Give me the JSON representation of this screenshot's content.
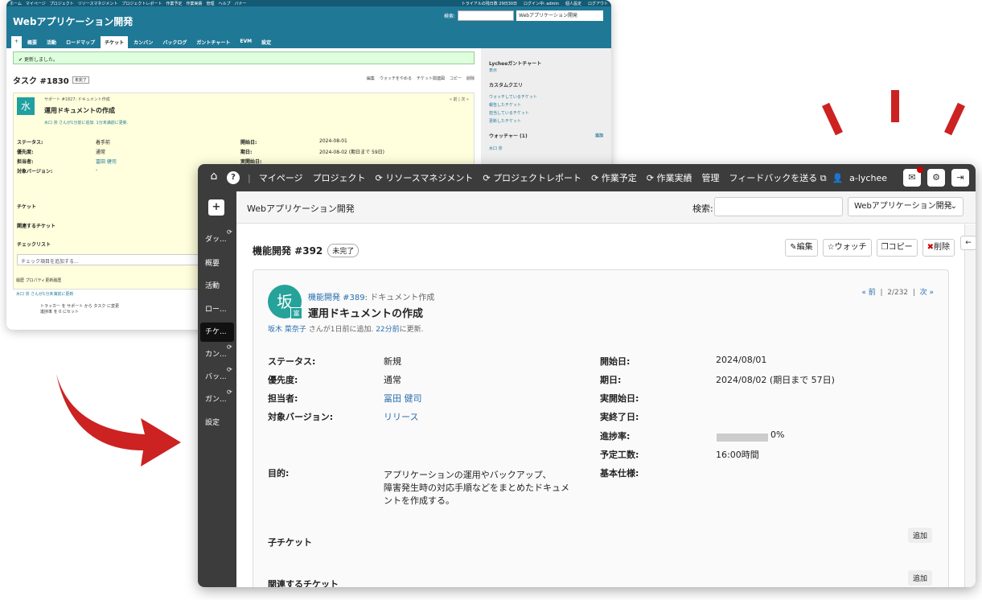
{
  "old": {
    "topbar": [
      "ホーム",
      "マイページ",
      "プロジェクト",
      "リソースマネジメント",
      "プロジェクトレポート",
      "作業予定",
      "作業実績",
      "管理",
      "ヘルプ",
      "バナー"
    ],
    "topbar_right": [
      "トライアルの残日数 29日30日",
      "ログイン中: admin",
      "個人設定",
      "ログアウト"
    ],
    "title": "Webアプリケーション開発",
    "search_label": "検索:",
    "project_select": "Webアプリケーション開発",
    "tabs": [
      "+",
      "概要",
      "活動",
      "ロードマップ",
      "チケット",
      "カンバン",
      "バックログ",
      "ガントチャート",
      "EVM",
      "設定"
    ],
    "flash": "更新しました。",
    "issue_title": "タスク #1830",
    "status_badge": "未完了",
    "actions": [
      "編集",
      "ウォッチをやめる",
      "チケット関連図",
      "コピー",
      "削除"
    ],
    "avatar": "水",
    "subject_parent": "サポート #1827: ドキュメント作成",
    "subject": "運用ドキュメントの作成",
    "by": "水口 崇 さんが1分前に追加. 1分未満前に更新.",
    "nav": "« 前 | 次 »",
    "attrs": [
      [
        "ステータス:",
        "着手前",
        "開始日:",
        "2024-08-01"
      ],
      [
        "優先度:",
        "通常",
        "期日:",
        "2024-08-02 (期日まで 59日)"
      ],
      [
        "担当者:",
        "冨田 健司",
        "実開始日:",
        ""
      ],
      [
        "対象バージョン:",
        "-",
        "",
        ""
      ]
    ],
    "sections": [
      "チケット",
      "関連するチケット",
      "チェックリスト"
    ],
    "checklist_placeholder": "チェック項目を追加する...",
    "history_tabs": "履歴    プロパティ更新履歴",
    "history": "水口 崇 さんが1分未満前に更新",
    "history_items": [
      "トラッカー を サポート から タスク に変更",
      "進捗率 を 0 にセット"
    ],
    "side": {
      "gantt_title": "Lycheeガントチャート",
      "gantt_link": "表示",
      "query_title": "カスタムクエリ",
      "queries": [
        "ウォッチしているチケット",
        "報告したチケット",
        "担当しているチケット",
        "更新したチケット"
      ],
      "watchers": "ウォッチャー (1)",
      "watcher_add": "追加",
      "watcher": "水口 崇"
    }
  },
  "new": {
    "menu": [
      "マイページ",
      "プロジェクト",
      "リソースマネジメント",
      "プロジェクトレポート",
      "作業予定",
      "作業実績",
      "管理",
      "フィードバックを送る"
    ],
    "user": "a-lychee",
    "project_title": "Webアプリケーション開発",
    "search_label": "検索:",
    "project_select": "Webアプリケーション開発",
    "nav": [
      "ダッ...",
      "概要",
      "活動",
      "ロー...",
      "チケ...",
      "カン...",
      "バッ...",
      "ガン...",
      "設定"
    ],
    "issue_title": "機能開発 #392",
    "status_badge": "未完了",
    "buttons": [
      "編集",
      "ウォッチ",
      "コピー",
      "削除"
    ],
    "avatar": "坂",
    "avatar_sub": "富",
    "parent_link": "機能開発 #389",
    "parent_rest": ": ドキュメント作成",
    "subject": "運用ドキュメントの作成",
    "author": "坂木 菜奈子",
    "by_rest": " さんが1日前に追加. ",
    "updated": "22分前",
    "by_end": "に更新.",
    "pn_prev": "« 前",
    "pn_count": "2/232",
    "pn_next": "次 »",
    "attrs": {
      "status_l": "ステータス:",
      "status": "新規",
      "priority_l": "優先度:",
      "priority": "通常",
      "assignee_l": "担当者:",
      "assignee": "冨田 健司",
      "version_l": "対象バージョン:",
      "version": "リリース",
      "start_l": "開始日:",
      "start": "2024/08/01",
      "due_l": "期日:",
      "due": "2024/08/02 (期日まで 57日)",
      "astart_l": "実開始日:",
      "aend_l": "実終了日:",
      "progress_l": "進捗率:",
      "progress": "0%",
      "progress_value": 0,
      "est_l": "予定工数:",
      "est": "16:00時間",
      "spec_l": "基本仕様:",
      "purpose_l": "目的:",
      "purpose": [
        "アプリケーションの運用やバックアップ、",
        "障害発生時の対応手順などをまとめたドキュメ",
        "ントを作成する。"
      ]
    },
    "child": "子チケット",
    "related": "関連するチケット",
    "add": "追加"
  },
  "colors": {
    "arrow": "#cc2222",
    "old_header": "#1f7896",
    "nav_bg": "#3c3c3c"
  }
}
